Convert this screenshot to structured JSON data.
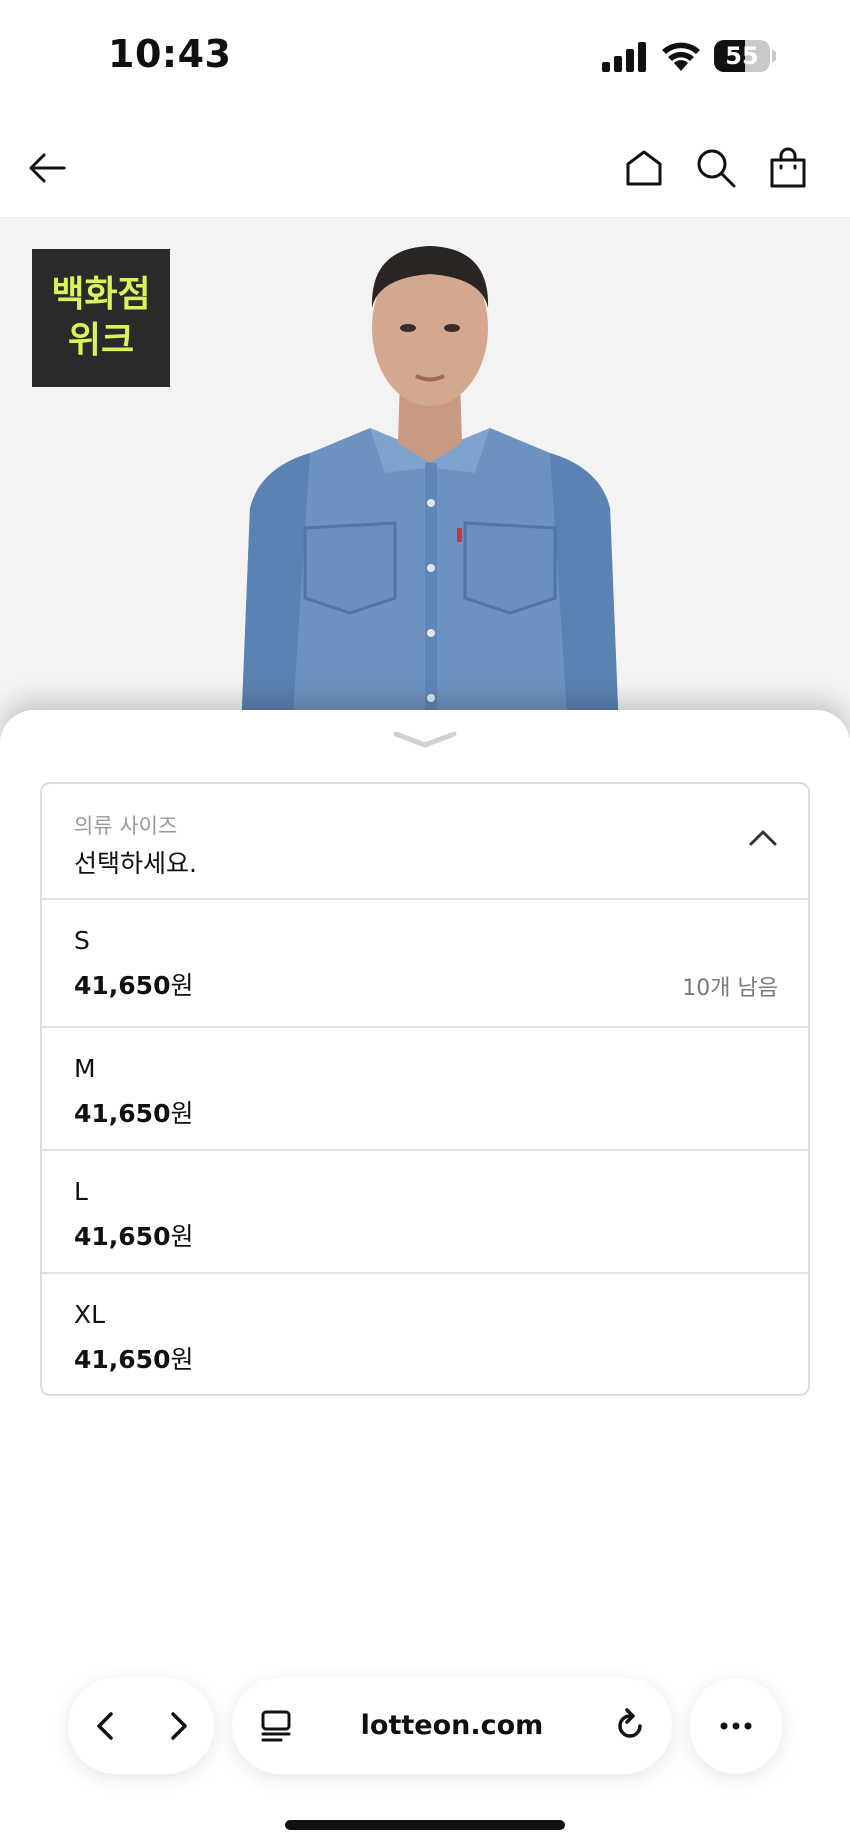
{
  "status_bar": {
    "time": "10:43",
    "battery_level": "55",
    "battery_fraction": 0.55,
    "icons": [
      "signal-icon",
      "wifi-icon",
      "battery-icon"
    ]
  },
  "top_nav": {
    "icons": [
      "back-arrow-icon",
      "home-icon",
      "search-icon",
      "shopping-bag-icon"
    ]
  },
  "product": {
    "promo_badge_line1": "백화점",
    "promo_badge_line2": "위크",
    "badge_text_color": "#d8f45a",
    "badge_bg_color": "#2a2a2a"
  },
  "size_selector": {
    "label": "의류 사이즈",
    "placeholder": "선택하세요.",
    "options": [
      {
        "name": "S",
        "price": "41,650",
        "currency": "원",
        "stock": "10개 남음"
      },
      {
        "name": "M",
        "price": "41,650",
        "currency": "원",
        "stock": ""
      },
      {
        "name": "L",
        "price": "41,650",
        "currency": "원",
        "stock": ""
      },
      {
        "name": "XL",
        "price": "41,650",
        "currency": "원",
        "stock": ""
      }
    ]
  },
  "browser_toolbar": {
    "url": "lotteon.com",
    "icons": [
      "back-chevron-icon",
      "forward-chevron-icon",
      "tabs-icon",
      "reload-icon",
      "more-icon"
    ]
  }
}
